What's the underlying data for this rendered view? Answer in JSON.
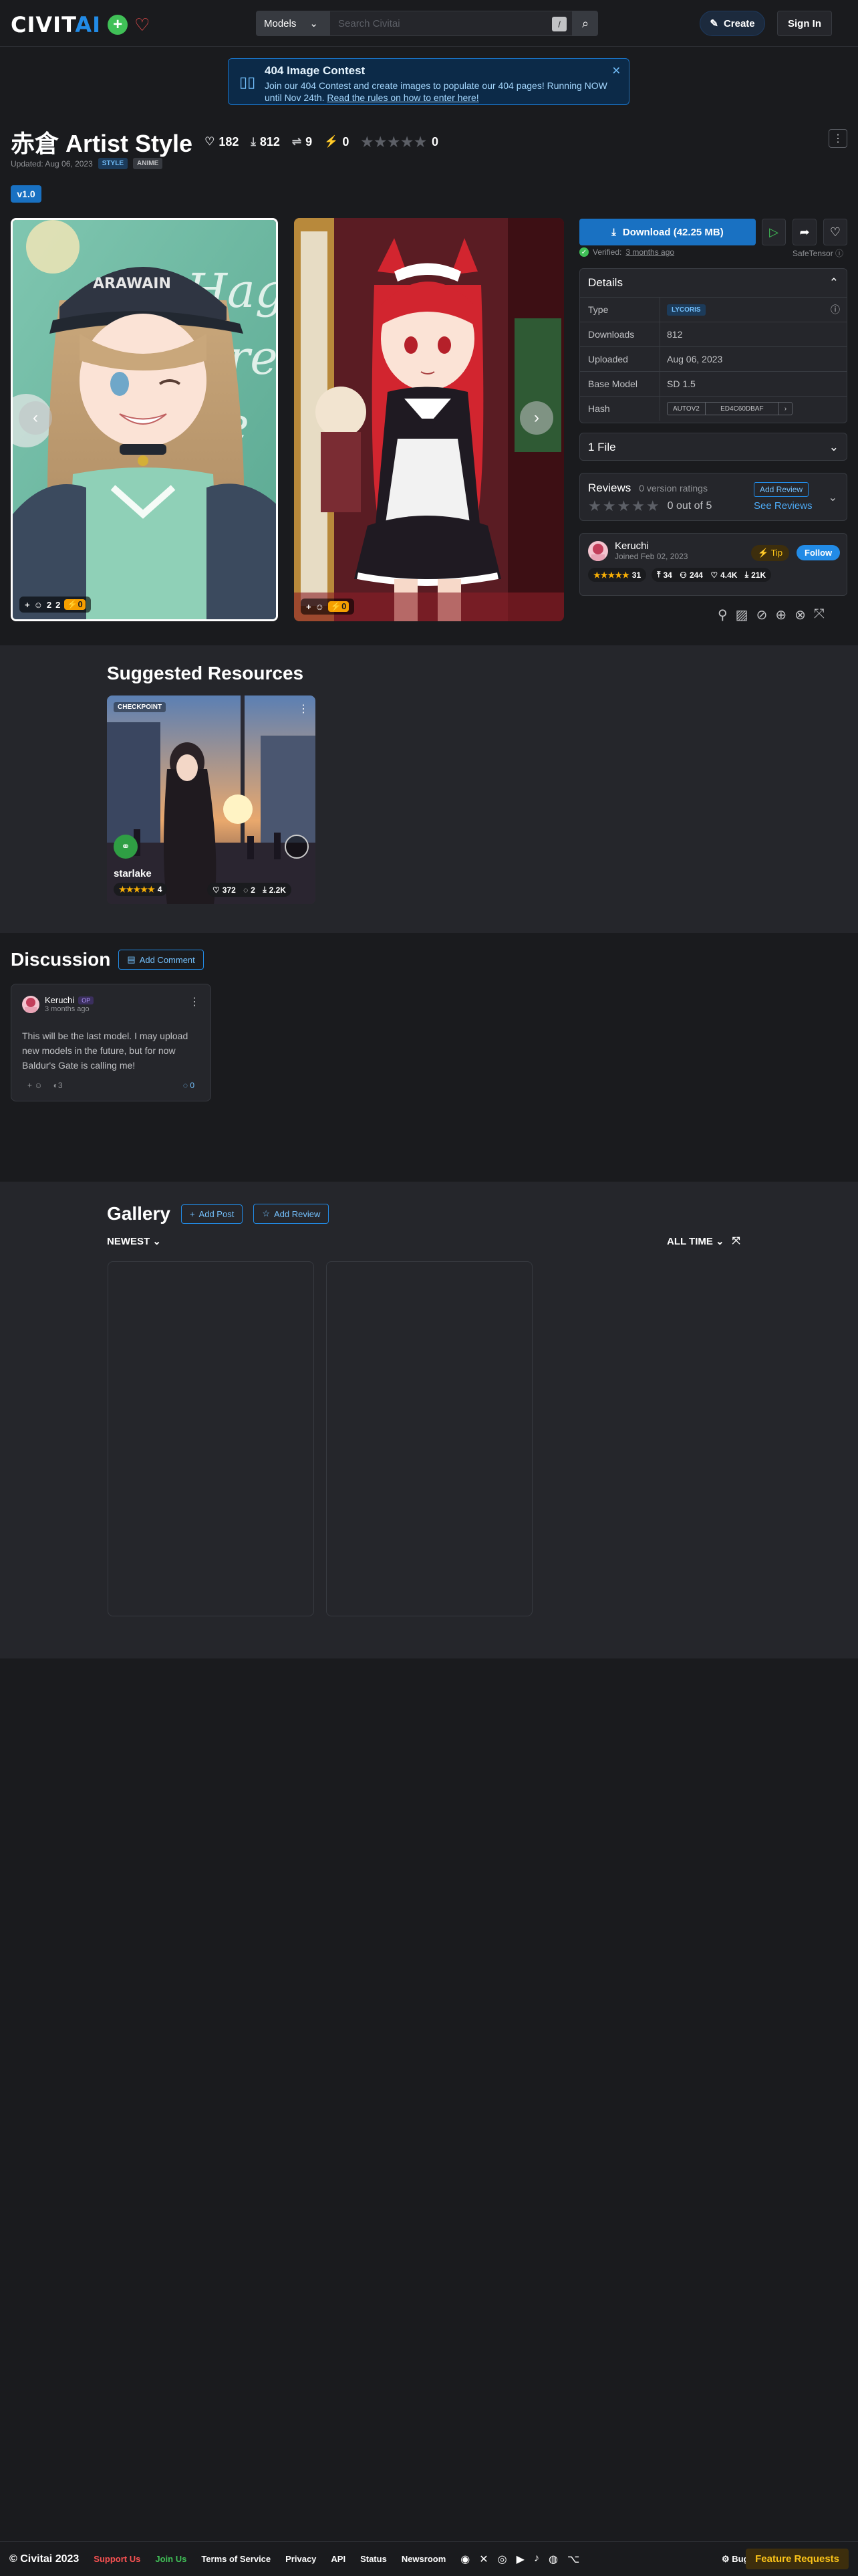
{
  "header": {
    "logo_main": "CIVIT",
    "logo_ai": "AI",
    "search_scope": "Models",
    "search_placeholder": "Search Civitai",
    "search_shortcut": "/",
    "create_label": "Create",
    "signin_label": "Sign In"
  },
  "announcement": {
    "title": "404 Image Contest",
    "body": "Join our 404 Contest and create images to populate our 404 pages! Running NOW until Nov 24th.",
    "link": "Read the rules on how to enter here!"
  },
  "model": {
    "title": "赤倉 Artist Style",
    "likes": "182",
    "downloads": "812",
    "comments": "9",
    "buzz": "0",
    "rating_count": "0",
    "updated": "Updated: Aug 06, 2023",
    "tags": [
      "STYLE",
      "ANIME"
    ],
    "version": "v1.0"
  },
  "images": [
    {
      "reactions": [
        "2",
        "2"
      ],
      "buzz": "0"
    },
    {
      "buzz": "0"
    }
  ],
  "download": {
    "label": "Download (42.25 MB)",
    "verified_prefix": "Verified:",
    "verified_when": "3 months ago",
    "safety": "SafeTensor"
  },
  "details": {
    "title": "Details",
    "rows": [
      {
        "key": "Type",
        "value": "LYCORIS"
      },
      {
        "key": "Downloads",
        "value": "812"
      },
      {
        "key": "Uploaded",
        "value": "Aug 06, 2023"
      },
      {
        "key": "Base Model",
        "value": "SD 1.5"
      },
      {
        "key": "Hash",
        "value_a": "AUTOV2",
        "value_b": "ED4C60DBAF"
      }
    ]
  },
  "files": {
    "title": "1 File"
  },
  "reviews": {
    "title": "Reviews",
    "subtitle": "0 version ratings",
    "score": "0 out of 5",
    "add_label": "Add Review",
    "see_label": "See Reviews"
  },
  "creator": {
    "name": "Keruchi",
    "joined": "Joined Feb 02, 2023",
    "tip_label": "Tip",
    "follow_label": "Follow",
    "rating": "31",
    "uploads": "34",
    "followers": "244",
    "likes": "4.4K",
    "downloads": "21K"
  },
  "suggested": {
    "title": "Suggested Resources",
    "card": {
      "badge": "CHECKPOINT",
      "name": "starlake",
      "rating": "4",
      "likes": "372",
      "comments": "2",
      "downloads": "2.2K"
    }
  },
  "discussion": {
    "title": "Discussion",
    "add_label": "Add Comment",
    "comment": {
      "author": "Keruchi",
      "badge": "OP",
      "when": "3 months ago",
      "text": "This will be the last model. I may upload new models in the future, but for now Baldur's Gate is calling me!",
      "reaction_count": "3",
      "reply_count": "0"
    }
  },
  "gallery": {
    "title": "Gallery",
    "add_post": "Add Post",
    "add_review": "Add Review",
    "sort": "NEWEST",
    "period": "ALL TIME"
  },
  "footer": {
    "copyright": "© Civitai 2023",
    "support": "Support Us",
    "join": "Join Us",
    "links": [
      "Terms of Service",
      "Privacy",
      "API",
      "Status",
      "Newsroom"
    ],
    "bugs": "Bugs",
    "feature": "Feature Requests"
  }
}
